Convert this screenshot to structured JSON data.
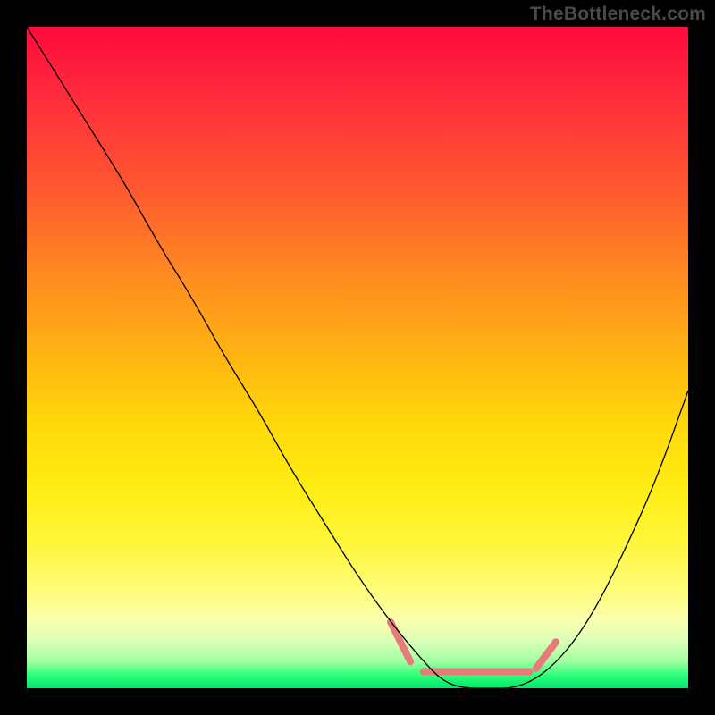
{
  "watermark": "TheBottleneck.com",
  "chart_data": {
    "type": "line",
    "title": "",
    "xlabel": "",
    "ylabel": "",
    "xlim": [
      0,
      100
    ],
    "ylim": [
      0,
      100
    ],
    "grid": false,
    "legend": false,
    "gradient_stops": [
      {
        "pos": 0,
        "color": "#ff0a3c"
      },
      {
        "pos": 25,
        "color": "#ff5a2e"
      },
      {
        "pos": 50,
        "color": "#ffb512"
      },
      {
        "pos": 75,
        "color": "#fff63a"
      },
      {
        "pos": 95,
        "color": "#9effa0"
      },
      {
        "pos": 100,
        "color": "#00e86a"
      }
    ],
    "series": [
      {
        "name": "bottleneck-curve",
        "color": "#000000",
        "stroke_width": 1.3,
        "x": [
          0,
          5,
          10,
          15,
          20,
          25,
          30,
          35,
          40,
          45,
          50,
          55,
          60,
          63,
          66,
          70,
          74,
          78,
          82,
          86,
          90,
          95,
          100
        ],
        "y": [
          100,
          92,
          84,
          76,
          67,
          59,
          50,
          42,
          33,
          25,
          17,
          10,
          4,
          1,
          0,
          0,
          0,
          2,
          6,
          12,
          20,
          31,
          45
        ]
      }
    ],
    "marker_band": {
      "name": "plateau-markers",
      "color": "#e97a7a",
      "stroke_width": 8,
      "segments": [
        {
          "x": [
            55,
            58
          ],
          "y": [
            10,
            4
          ]
        },
        {
          "x": [
            60,
            76
          ],
          "y": [
            2.5,
            2.5
          ]
        },
        {
          "x": [
            77,
            80
          ],
          "y": [
            3,
            7
          ]
        }
      ]
    }
  }
}
